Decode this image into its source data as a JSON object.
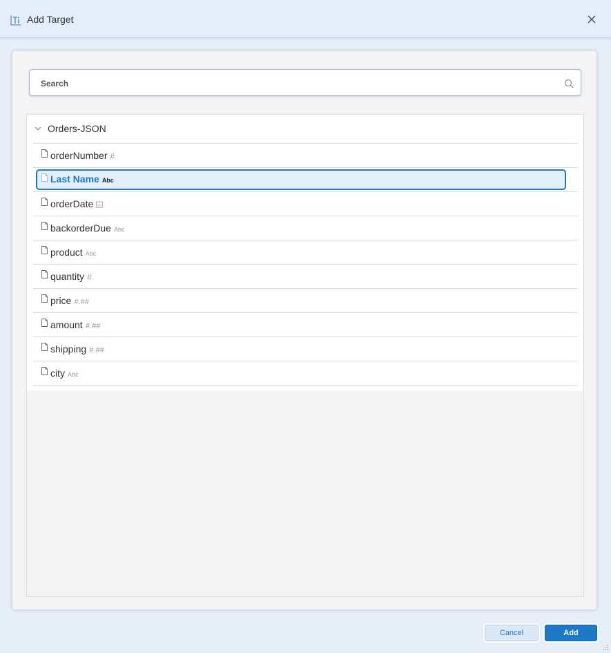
{
  "dialog": {
    "title": "Add Target",
    "title_icon": "target-table-icon",
    "close_icon": "close-icon"
  },
  "search": {
    "placeholder": "Search",
    "value": "",
    "icon": "search-icon"
  },
  "tree": {
    "root_label": "Orders-JSON",
    "expanded": true,
    "items": [
      {
        "label": "orderNumber",
        "type": "#",
        "type_kind": "number",
        "selected": false
      },
      {
        "label": "Last Name",
        "type": "Abc",
        "type_kind": "string",
        "selected": true
      },
      {
        "label": "orderDate",
        "type": "",
        "type_kind": "date",
        "selected": false
      },
      {
        "label": "backorderDue",
        "type": "Abc",
        "type_kind": "string",
        "selected": false
      },
      {
        "label": "product",
        "type": "Abc",
        "type_kind": "string",
        "selected": false
      },
      {
        "label": "quantity",
        "type": "#",
        "type_kind": "number",
        "selected": false
      },
      {
        "label": "price",
        "type": "#.##",
        "type_kind": "decimal",
        "selected": false
      },
      {
        "label": "amount",
        "type": "#.##",
        "type_kind": "decimal",
        "selected": false
      },
      {
        "label": "shipping",
        "type": "#.##",
        "type_kind": "decimal",
        "selected": false
      },
      {
        "label": "city",
        "type": "Abc",
        "type_kind": "string",
        "selected": false
      }
    ]
  },
  "buttons": {
    "cancel_label": "Cancel",
    "add_label": "Add"
  },
  "colors": {
    "accent": "#1e78c8",
    "selection_bg": "#e2eef9",
    "titlebar_bg": "#e3eefa"
  }
}
